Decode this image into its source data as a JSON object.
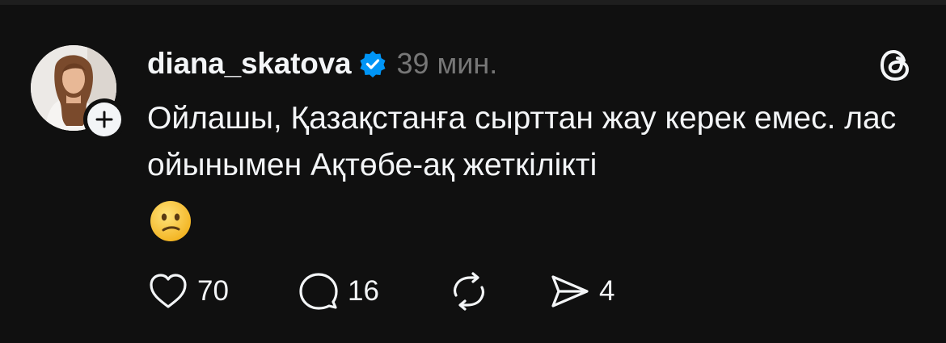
{
  "post": {
    "username": "diana_skatova",
    "verified": true,
    "timestamp": "39 мин.",
    "text": "Ойлашы, Қазақстанға сырттан жау керек емес. лас ойынымен Ақтөбе-ақ жеткілікті",
    "emoji": "confused-face"
  },
  "actions": {
    "likes": "70",
    "replies": "16",
    "shares": "4"
  },
  "icons": {
    "like": "heart-icon",
    "reply": "comment-icon",
    "repost": "repost-icon",
    "share": "send-icon",
    "app": "threads-logo",
    "follow": "plus-icon"
  },
  "colors": {
    "background": "#101010",
    "text": "#f3f5f7",
    "muted": "#777777",
    "verified": "#0095f6",
    "emoji": "#f7c33b"
  }
}
